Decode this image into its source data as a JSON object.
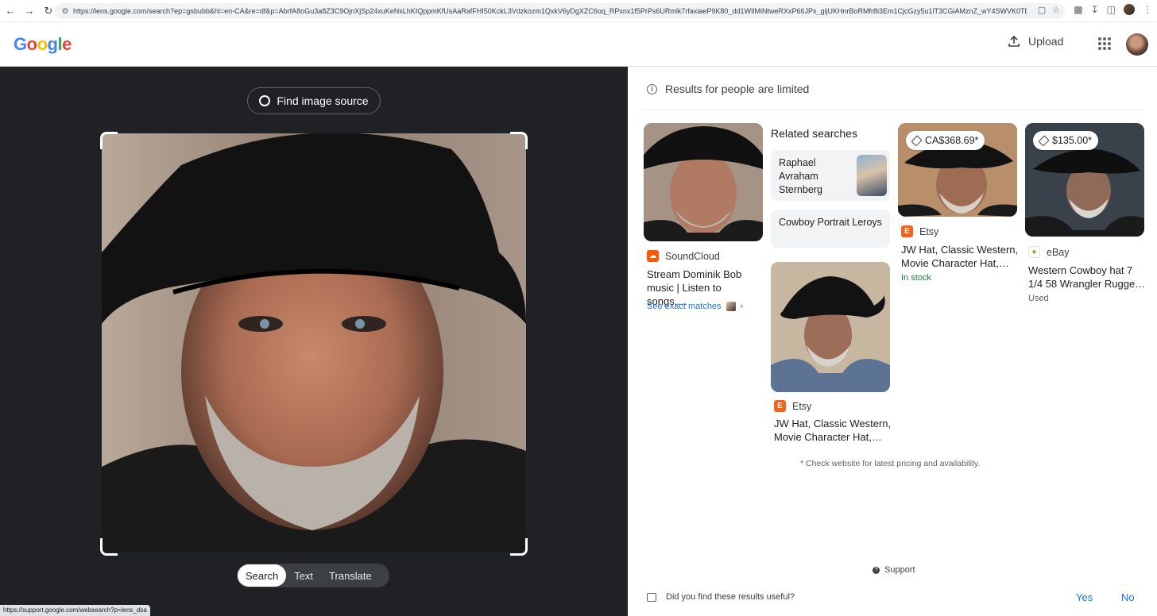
{
  "browser": {
    "url": "https://lens.google.com/search?ep=gsbubb&hl=en-CA&re=df&p=AbrfA8oGu3a8Z3C9OjnXjSp24xuKeNsLhKIQppmKfUsAaRafFHI50KckL3Vdzkozm1QxkV6yDgXZC6oq_RPxnx1f5PrPs6URmlk7rfaxiaeP9K80_dd1WIlMiNtweRXxP66JPx_gijUKHnrBoRMfr8i3Em1CjcGzy5u1lT3CGiAMznZ_wY4SWVK0TD9e8eAH0sQRn7EWScv7avMID05LqbPoJePrg1K_s..."
  },
  "header": {
    "logo_letters": [
      "G",
      "o",
      "o",
      "g",
      "l",
      "e"
    ],
    "upload_label": "Upload"
  },
  "left": {
    "find_source_label": "Find image source",
    "tabs": [
      "Search",
      "Text",
      "Translate"
    ],
    "active_tab": "Search",
    "status_url": "https://support.google.com/websearch?p=lens_dsa"
  },
  "right": {
    "limited_notice": "Results for people are limited",
    "related_heading": "Related searches",
    "related": [
      {
        "label": "Raphael Avraham Sternberg"
      },
      {
        "label": "Cowboy Portrait Leroys"
      }
    ],
    "cards": [
      {
        "source": "SoundCloud",
        "title": "Stream Dominik Bob music | Listen to songs,…"
      },
      {
        "source": "Etsy",
        "title": "JW Hat, Classic Western, Movie Character Hat,…"
      },
      {
        "source": "Etsy",
        "title": "JW Hat, Classic Western, Movie Character Hat,…",
        "price": "CA$368.69*",
        "availability": "In stock"
      },
      {
        "source": "eBay",
        "title": "Western Cowboy hat 7 1/4 58 Wrangler Rugge…",
        "price": "$135.00*",
        "condition": "Used"
      }
    ],
    "see_exact_matches": "See exact matches",
    "disclaimer": "* Check website for latest pricing and availability.",
    "support_label": "Support",
    "feedback_question": "Did you find these results useful?",
    "feedback_yes": "Yes",
    "feedback_no": "No"
  },
  "colors": {
    "accent_blue": "#1a73e8",
    "in_stock_green": "#188038",
    "dark_pane": "#202124",
    "soundcloud_orange": "#ff5500",
    "etsy_orange": "#f1641e"
  }
}
